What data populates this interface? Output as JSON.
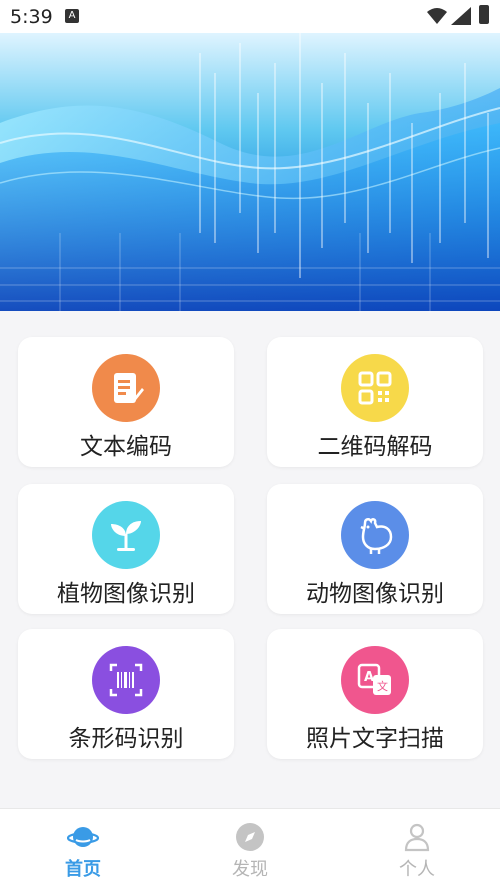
{
  "status_bar": {
    "time": "5:39",
    "notification": "A"
  },
  "features": [
    {
      "label": "文本编码",
      "icon": "document-edit-icon",
      "color": "#f08a4b"
    },
    {
      "label": "二维码解码",
      "icon": "qr-code-icon",
      "color": "#f7d94a"
    },
    {
      "label": "植物图像识别",
      "icon": "plant-sprout-icon",
      "color": "#55d6e9"
    },
    {
      "label": "动物图像识别",
      "icon": "rooster-icon",
      "color": "#5b8ee8"
    },
    {
      "label": "条形码识别",
      "icon": "barcode-icon",
      "color": "#8a4fe0"
    },
    {
      "label": "照片文字扫描",
      "icon": "translate-icon",
      "color": "#f0568e"
    }
  ],
  "tabbar": {
    "items": [
      {
        "label": "首页",
        "icon": "planet-home-icon",
        "active": true
      },
      {
        "label": "发现",
        "icon": "compass-icon",
        "active": false
      },
      {
        "label": "个人",
        "icon": "person-icon",
        "active": false
      }
    ],
    "active_color": "#3a9be6",
    "inactive_color": "#b5b5b5"
  }
}
